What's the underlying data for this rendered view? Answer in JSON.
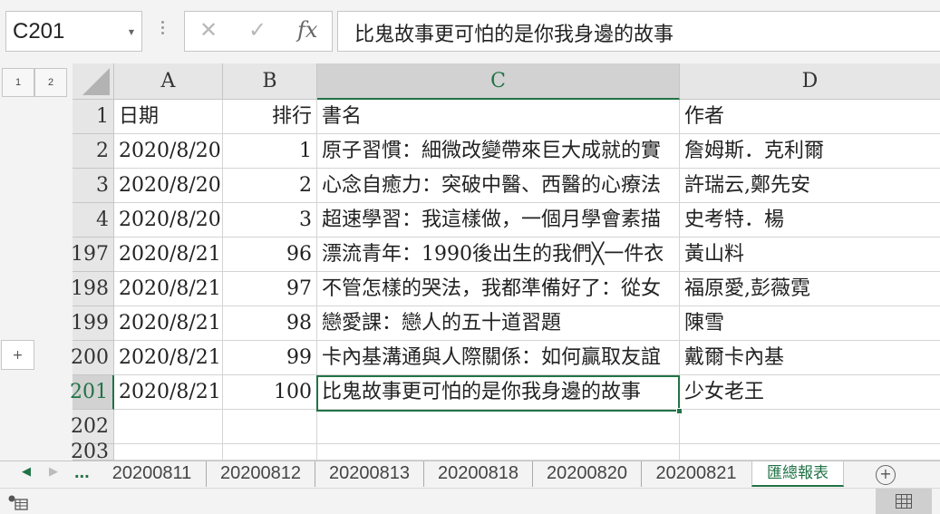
{
  "formula_bar": {
    "name_box": "C201",
    "cancel_glyph": "✕",
    "enter_glyph": "✓",
    "fx_label": "fx",
    "formula": "比鬼故事更可怕的是你我身邊的故事"
  },
  "outline": {
    "levels": [
      "1",
      "2"
    ],
    "expand_glyph": "+"
  },
  "columns": [
    "A",
    "B",
    "C",
    "D"
  ],
  "selected_column": "C",
  "selected_row": "201",
  "rows": [
    {
      "num": "1",
      "a": "日期",
      "b": "排行",
      "c": "書名",
      "d": "作者"
    },
    {
      "num": "2",
      "a": "2020/8/20",
      "b": "1",
      "c": "原子習慣：細微改變帶來巨大成就的實",
      "d": "詹姆斯．克利爾"
    },
    {
      "num": "3",
      "a": "2020/8/20",
      "b": "2",
      "c": "心念自癒力：突破中醫、西醫的心療法",
      "d": "許瑞云,鄭先安"
    },
    {
      "num": "4",
      "a": "2020/8/20",
      "b": "3",
      "c": "超速學習：我這樣做，一個月學會素描",
      "d": "史考特．楊"
    },
    {
      "num": "197",
      "a": "2020/8/21",
      "b": "96",
      "c": "漂流青年：1990後出生的我們╳一件衣",
      "d": "黃山料"
    },
    {
      "num": "198",
      "a": "2020/8/21",
      "b": "97",
      "c": "不管怎樣的哭法，我都準備好了：從女",
      "d": "福原愛,彭薇霓"
    },
    {
      "num": "199",
      "a": "2020/8/21",
      "b": "98",
      "c": "戀愛課：戀人的五十道習題",
      "d": "陳雪"
    },
    {
      "num": "200",
      "a": "2020/8/21",
      "b": "99",
      "c": "卡內基溝通與人際關係：如何贏取友誼",
      "d": "戴爾卡內基"
    },
    {
      "num": "201",
      "a": "2020/8/21",
      "b": "100",
      "c": "比鬼故事更可怕的是你我身邊的故事",
      "d": "少女老王"
    },
    {
      "num": "202",
      "a": "",
      "b": "",
      "c": "",
      "d": ""
    },
    {
      "num": "203",
      "a": "",
      "b": "",
      "c": "",
      "d": ""
    }
  ],
  "sheet_tabs": {
    "prev_glyph": "◀",
    "next_glyph": "▶",
    "more": "...",
    "tabs": [
      "20200811",
      "20200812",
      "20200813",
      "20200818",
      "20200820",
      "20200821",
      "匯總報表"
    ],
    "active": "匯總報表",
    "add_glyph": "+"
  },
  "colors": {
    "accent": "#217346",
    "header_bg": "#e6e6e6",
    "grid": "#d4d4d4"
  }
}
